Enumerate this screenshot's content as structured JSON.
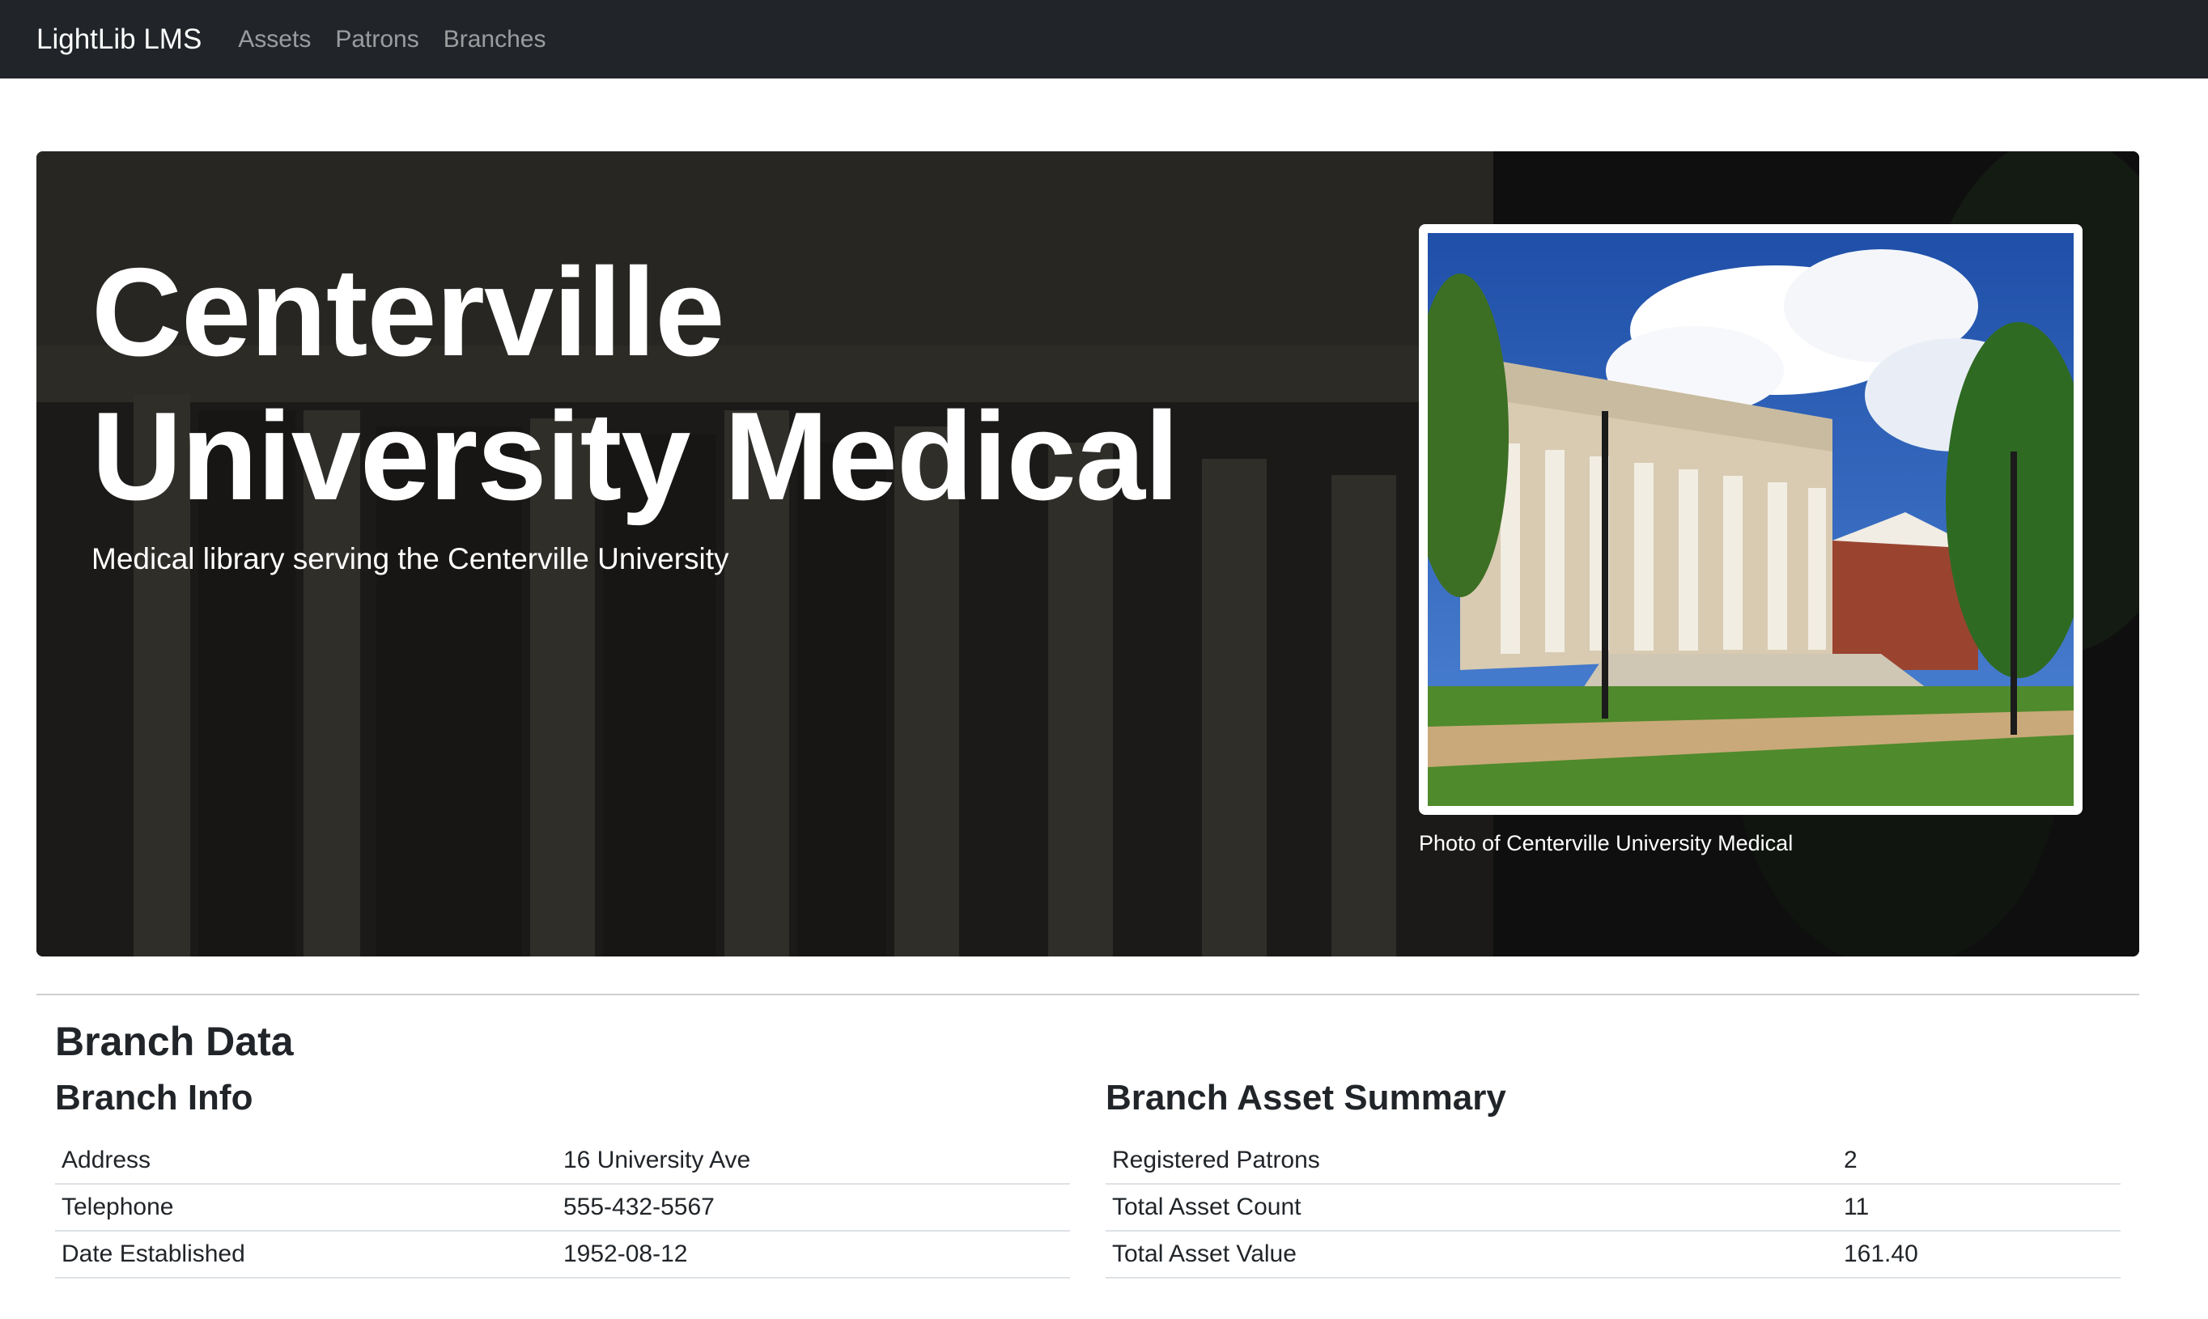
{
  "navbar": {
    "brand": "LightLib LMS",
    "links": [
      "Assets",
      "Patrons",
      "Branches"
    ]
  },
  "hero": {
    "title": "Centerville University Medical",
    "subtitle": "Medical library serving the Centerville University",
    "photo_caption": "Photo of Centerville University Medical"
  },
  "branch_data": {
    "heading": "Branch Data",
    "info": {
      "heading": "Branch Info",
      "rows": [
        {
          "label": "Address",
          "value": "16 University Ave"
        },
        {
          "label": "Telephone",
          "value": "555-432-5567"
        },
        {
          "label": "Date Established",
          "value": "1952-08-12"
        }
      ]
    },
    "summary": {
      "heading": "Branch Asset Summary",
      "rows": [
        {
          "label": "Registered Patrons",
          "value": "2"
        },
        {
          "label": "Total Asset Count",
          "value": "11"
        },
        {
          "label": "Total Asset Value",
          "value": "161.40"
        }
      ]
    }
  },
  "colors": {
    "navbar_bg": "#212529",
    "nav_link": "rgba(255,255,255,0.55)",
    "text": "#212529"
  }
}
